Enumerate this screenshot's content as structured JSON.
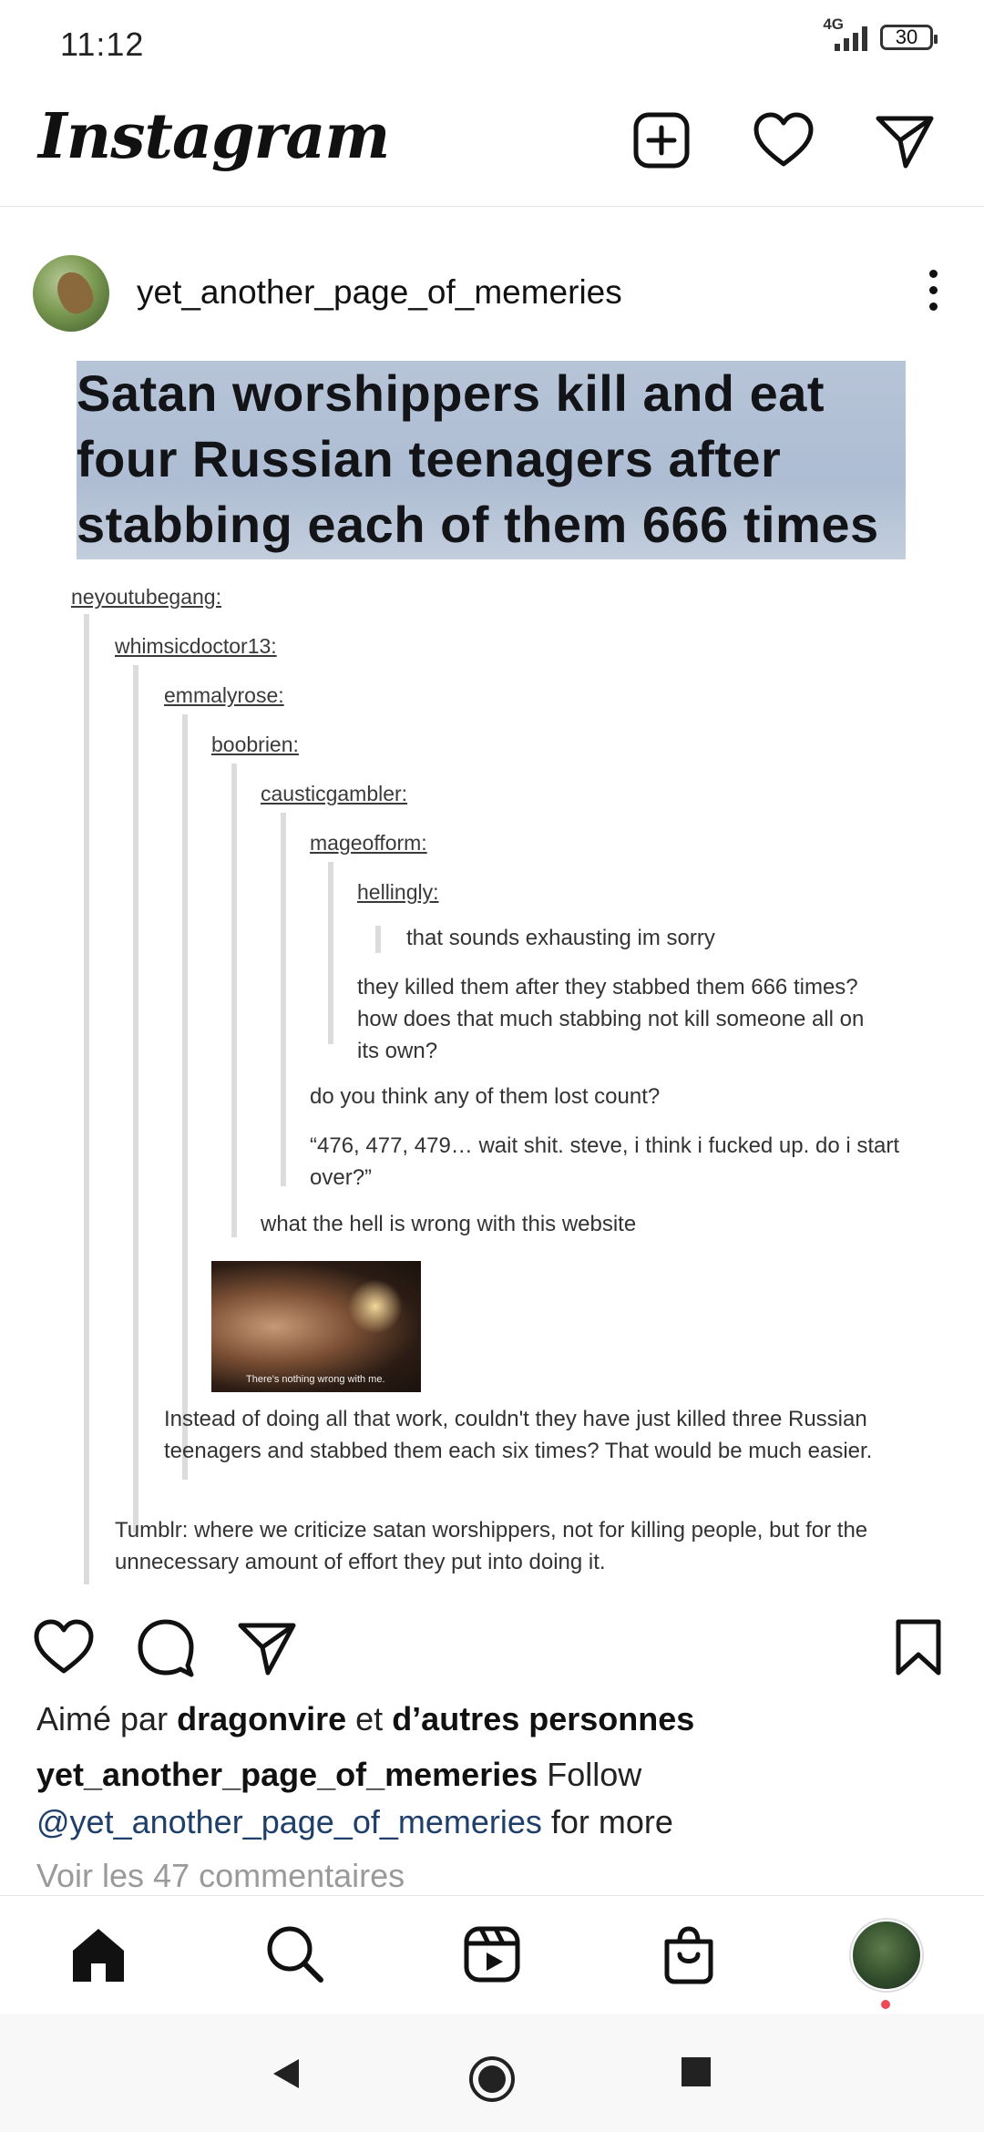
{
  "status_bar": {
    "time": "11:12",
    "network": "4G",
    "battery": "30"
  },
  "header": {
    "logo": "Instagram",
    "icons": [
      "new-post-icon",
      "heart-icon",
      "send-icon"
    ]
  },
  "post": {
    "username": "yet_another_page_of_memeries",
    "image": {
      "headline_lines": [
        "Satan worshippers kill and eat",
        "four Russian teenagers after",
        "stabbing each of them 666 times"
      ],
      "usernames": [
        "neyoutubegang:",
        "whimsicdoctor13:",
        "emmalyrose:",
        "boobrien:",
        "causticgambler:",
        "mageofform:",
        "hellingly:"
      ],
      "replies": {
        "hellingly_quote": "that sounds exhausting im sorry",
        "hellingly": "they killed them after they stabbed them 666 times?  how does that much stabbing not kill someone all on its own?",
        "mageofform_1": "do you think any of them lost count?",
        "mageofform_2": "“476, 477, 479… wait shit. steve, i think i fucked up. do i start over?”",
        "causticgambler": "what the hell is wrong with this website",
        "sherlock_caption": "There's nothing wrong with me.",
        "emmalyrose": "Instead of doing all that work, couldn't they have just killed three Russian teenagers and stabbed them each six times? That would be much easier.",
        "whimsicdoctor13": "Tumblr: where we criticize satan worshippers, not for killing people, but for the unnecessary amount of effort they put into doing it."
      }
    },
    "likes": {
      "prefix": "Aimé par",
      "user": "dragonvire",
      "middle": "et",
      "rest": "d’autres personnes"
    },
    "caption": {
      "user": "yet_another_page_of_memeries",
      "text": "Follow",
      "mention": "@yet_another_page_of_memeries",
      "suffix": "for more"
    },
    "view_comments": "Voir les 47 commentaires"
  },
  "bottom_nav": [
    "home-icon",
    "search-icon",
    "reels-icon",
    "shop-icon",
    "profile-avatar"
  ],
  "colors": {
    "mention": "#1f3f6b",
    "notification_dot": "#ed4956"
  }
}
